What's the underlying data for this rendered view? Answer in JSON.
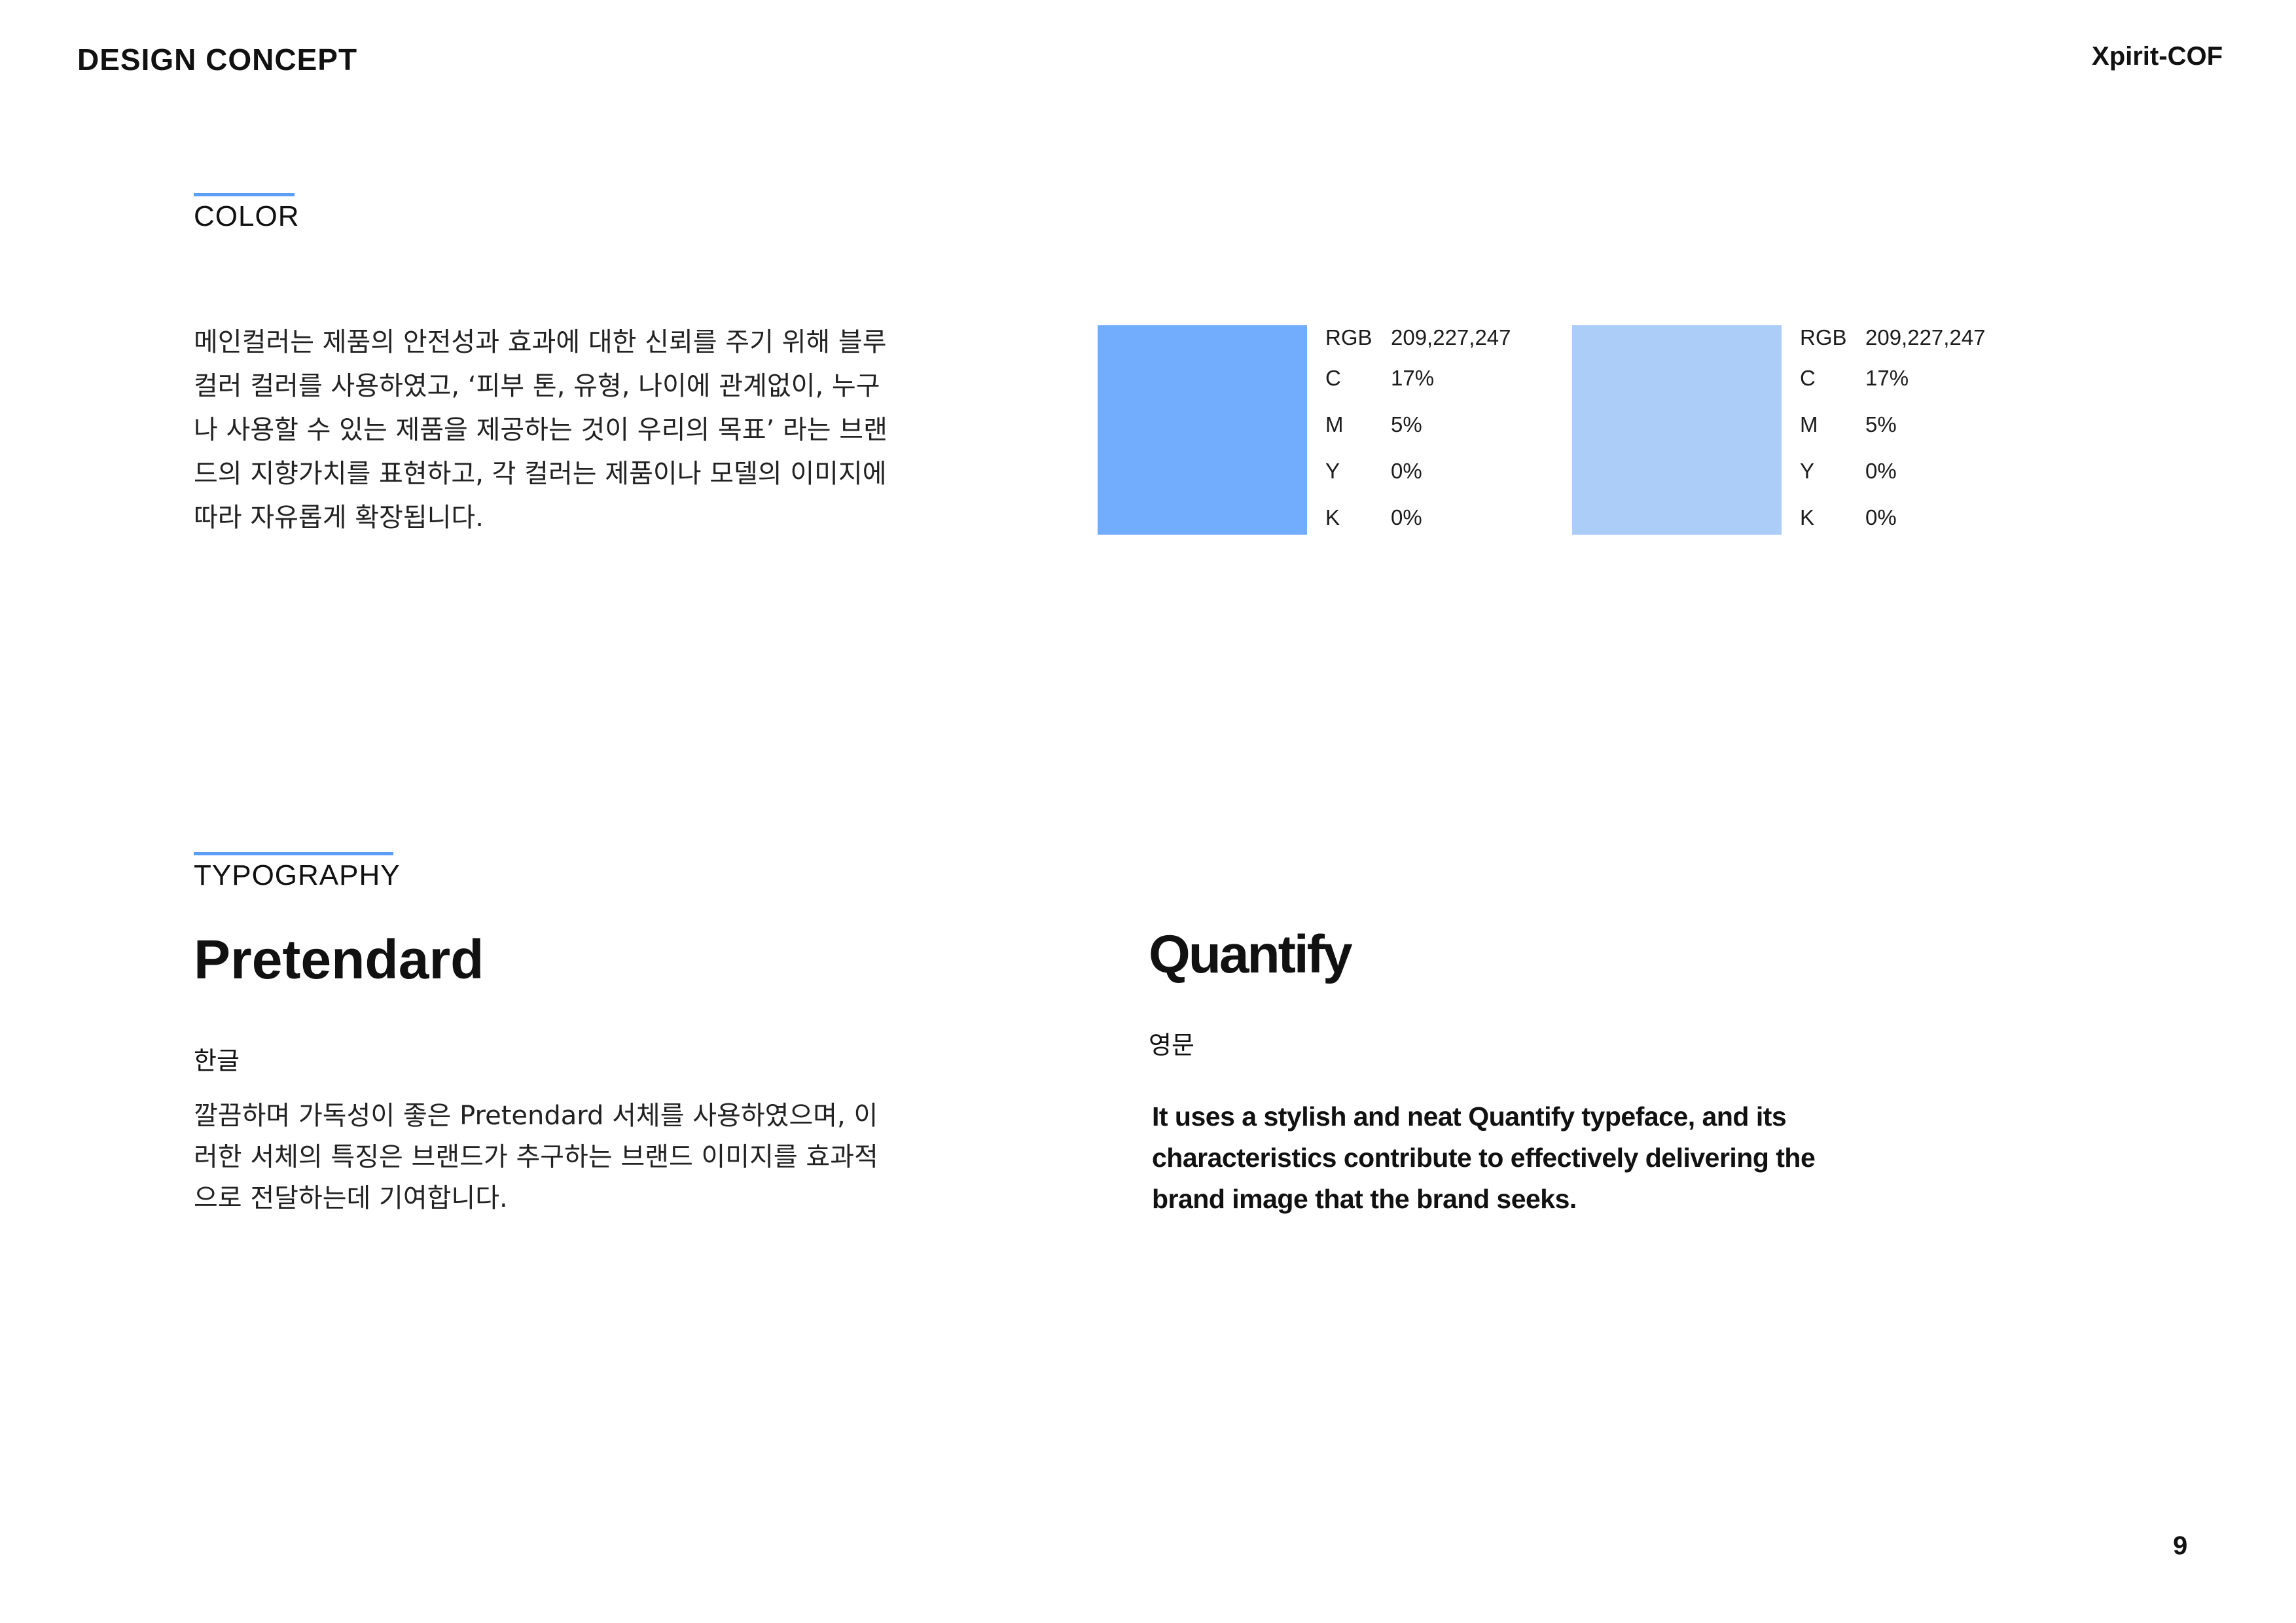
{
  "header": {
    "title": "DESIGN CONCEPT",
    "brand": "Xpirit-COF"
  },
  "color_section": {
    "label": "COLOR",
    "description": [
      "메인컬러는 제품의 안전성과 효과에 대한 신뢰를 주기 위해 블루",
      "컬러 컬러를 사용하였고, ‘피부 톤, 유형, 나이에 관계없이, 누구",
      "나 사용할 수 있는 제품을 제공하는 것이 우리의 목표’ 라는 브랜",
      "드의 지향가치를 표현하고, 각 컬러는 제품이나 모델의 이미지에",
      "따라 자유롭게 확장됩니다."
    ],
    "swatches": [
      {
        "color": "#72acfc",
        "specs": [
          {
            "key": "RGB",
            "value": "209,227,247"
          },
          {
            "key": "C",
            "value": "17%"
          },
          {
            "key": "M",
            "value": "5%"
          },
          {
            "key": "Y",
            "value": "0%"
          },
          {
            "key": "K",
            "value": "0%"
          }
        ]
      },
      {
        "color": "#abcdf8",
        "specs": [
          {
            "key": "RGB",
            "value": "209,227,247"
          },
          {
            "key": "C",
            "value": "17%"
          },
          {
            "key": "M",
            "value": "5%"
          },
          {
            "key": "Y",
            "value": "0%"
          },
          {
            "key": "K",
            "value": "0%"
          }
        ]
      }
    ]
  },
  "typography_section": {
    "label": "TYPOGRAPHY",
    "korean_font": {
      "name": "Pretendard",
      "sublabel": "한글",
      "description": [
        "깔끔하며 가독성이 좋은 Pretendard 서체를 사용하였으며, 이",
        "러한 서체의 특징은 브랜드가 추구하는 브랜드 이미지를 효과적",
        "으로 전달하는데 기여합니다."
      ]
    },
    "english_font": {
      "name": "Quantify",
      "sublabel": "영문",
      "description": [
        "It uses a stylish and neat Quantify typeface, and its",
        "characteristics contribute to effectively delivering the",
        "brand image that the brand seeks."
      ]
    }
  },
  "page_number": "9",
  "accent_color": "#5b9ef7"
}
